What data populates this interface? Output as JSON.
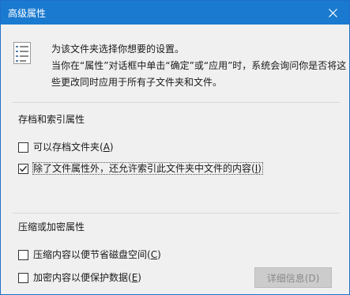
{
  "window": {
    "title": "高级属性",
    "close_icon": "close-icon",
    "accent_color": "#1a7ad0"
  },
  "description": {
    "icon": "properties-list-icon",
    "line1": "为该文件夹选择你想要的设置。",
    "line2": "当你在“属性”对话框中单击“确定”或“应用”时，系统会询问你是否将这",
    "line3": "些更改同时应用于所有子文件夹和文件。"
  },
  "archive_group": {
    "title": "存档和索引属性",
    "items": [
      {
        "label": "可以存档文件夹(",
        "mnemonic": "A",
        "suffix": ")",
        "checked": false
      },
      {
        "label": "除了文件属性外，还允许索引此文件夹中文件的内容(",
        "mnemonic": "I",
        "suffix": ")",
        "checked": true
      }
    ]
  },
  "compress_group": {
    "title": "压缩或加密属性",
    "items": [
      {
        "label": "压缩内容以便节省磁盘空间(",
        "mnemonic": "C",
        "suffix": ")",
        "checked": false
      },
      {
        "label": "加密内容以便保护数据(",
        "mnemonic": "E",
        "suffix": ")",
        "checked": false
      }
    ],
    "details_button": "详细信息(D)",
    "details_enabled": false
  }
}
